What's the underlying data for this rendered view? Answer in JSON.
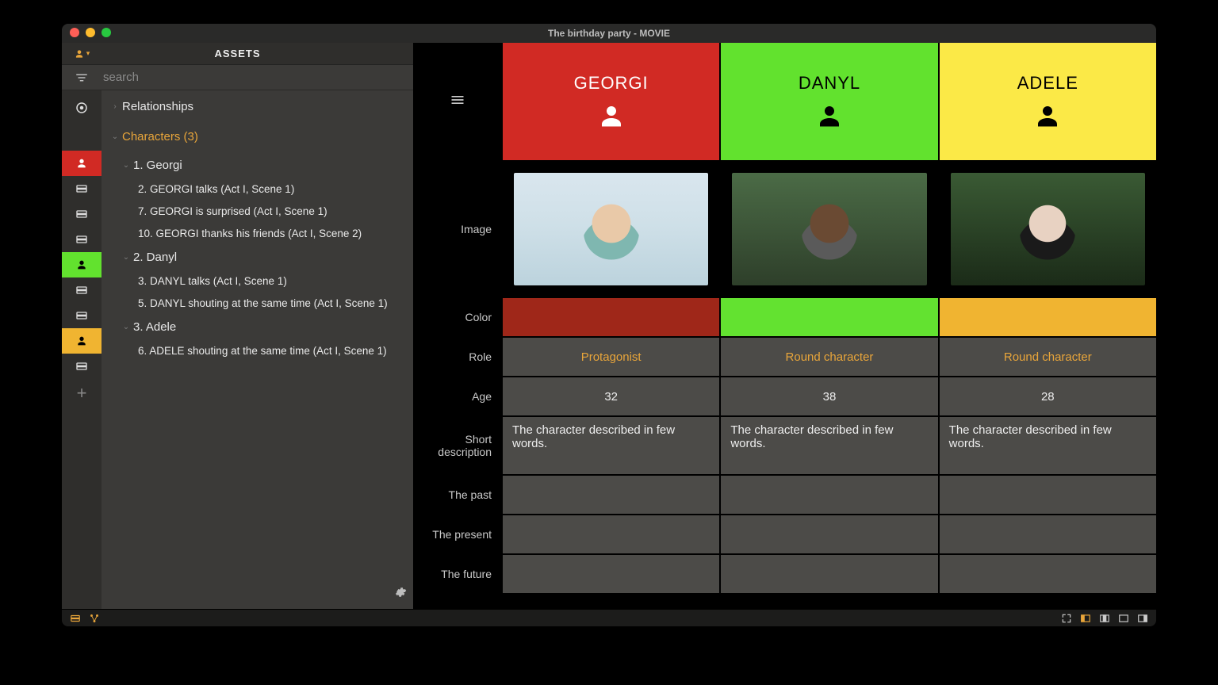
{
  "window": {
    "title": "The birthday party - MOVIE"
  },
  "sidebar": {
    "header": "ASSETS",
    "search_placeholder": "search",
    "tree": {
      "relationships": "Relationships",
      "characters": "Characters (3)",
      "items": [
        {
          "label": "1. Georgi",
          "chip": "red",
          "scenes": [
            "2. GEORGI talks (Act I, Scene 1)",
            "7. GEORGI is surprised (Act I, Scene 1)",
            "10. GEORGI thanks his friends (Act I, Scene 2)"
          ]
        },
        {
          "label": "2. Danyl",
          "chip": "green",
          "scenes": [
            "3. DANYL talks (Act I, Scene 1)",
            "5. DANYL shouting at the same time (Act I, Scene 1)"
          ]
        },
        {
          "label": "3. Adele",
          "chip": "yellow",
          "scenes": [
            "6. ADELE shouting at the same time (Act I, Scene 1)"
          ]
        }
      ]
    }
  },
  "main": {
    "characters": [
      {
        "name": "GEORGI",
        "header_color": "#d12a24",
        "color_cell": "#9f2719"
      },
      {
        "name": "DANYL",
        "header_color": "#62e22e",
        "color_cell": "#63e230"
      },
      {
        "name": "ADELE",
        "header_color": "#fbe947",
        "color_cell": "#f0b431"
      }
    ],
    "rows": {
      "image": "Image",
      "color": "Color",
      "role": "Role",
      "age": "Age",
      "short_desc": "Short description",
      "past": "The past",
      "present": "The present",
      "future": "The future"
    },
    "values": {
      "role": [
        "Protagonist",
        "Round character",
        "Round character"
      ],
      "age": [
        "32",
        "38",
        "28"
      ],
      "short": [
        "The character described in few words.",
        "The character described in few words.",
        "The character described in few words."
      ],
      "past": [
        "",
        "",
        ""
      ],
      "present": [
        "",
        "",
        ""
      ],
      "future": [
        "",
        "",
        ""
      ]
    }
  }
}
